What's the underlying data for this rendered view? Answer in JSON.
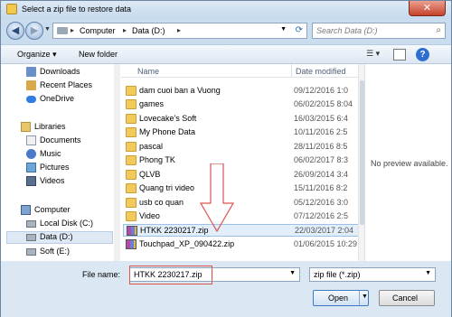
{
  "window": {
    "title": "Select a zip file to restore data",
    "close_glyph": "✕"
  },
  "nav": {
    "back_glyph": "◀",
    "forward_glyph": "▶",
    "address": [
      "Computer",
      "Data (D:)"
    ],
    "search_placeholder": "Search Data (D:)"
  },
  "toolbar": {
    "organize": "Organize ▾",
    "new_folder": "New folder",
    "help": "?"
  },
  "sidebar": {
    "items": [
      {
        "label": "Downloads",
        "icon": "downloads-icon"
      },
      {
        "label": "Recent Places",
        "icon": "recent-places-icon"
      },
      {
        "label": "OneDrive",
        "icon": "onedrive-icon"
      },
      {
        "label": "Libraries",
        "icon": "libraries-icon"
      },
      {
        "label": "Documents",
        "icon": "documents-icon"
      },
      {
        "label": "Music",
        "icon": "music-icon"
      },
      {
        "label": "Pictures",
        "icon": "pictures-icon"
      },
      {
        "label": "Videos",
        "icon": "videos-icon"
      },
      {
        "label": "Computer",
        "icon": "computer-icon"
      },
      {
        "label": "Local Disk (C:)",
        "icon": "drive-icon"
      },
      {
        "label": "Data (D:)",
        "icon": "drive-icon",
        "selected": true
      },
      {
        "label": "Soft  (E:)",
        "icon": "drive-icon"
      }
    ]
  },
  "filelist": {
    "columns": {
      "name": "Name",
      "date": "Date modified"
    },
    "rows": [
      {
        "name": "dam cuoi ban a Vuong",
        "date": "09/12/2016 1:0",
        "type": "folder"
      },
      {
        "name": "games",
        "date": "06/02/2015 8:04",
        "type": "folder"
      },
      {
        "name": "Lovecake's Soft",
        "date": "16/03/2015 6:4",
        "type": "folder"
      },
      {
        "name": "My Phone Data",
        "date": "10/11/2016 2:5",
        "type": "folder"
      },
      {
        "name": "pascal",
        "date": "28/11/2016 8:5",
        "type": "folder"
      },
      {
        "name": "Phong TK",
        "date": "06/02/2017 8:3",
        "type": "folder"
      },
      {
        "name": "QLVB",
        "date": "26/09/2014 3:4",
        "type": "folder"
      },
      {
        "name": "Quang tri video",
        "date": "15/11/2016 8:2",
        "type": "folder"
      },
      {
        "name": "usb co quan",
        "date": "05/12/2016 3:0",
        "type": "folder"
      },
      {
        "name": "Video",
        "date": "07/12/2016 2:5",
        "type": "folder"
      },
      {
        "name": "HTKK 2230217.zip",
        "date": "22/03/2017 2:04",
        "type": "zip",
        "selected": true
      },
      {
        "name": "Touchpad_XP_090422.zip",
        "date": "01/06/2015 10:29",
        "type": "zip"
      }
    ]
  },
  "preview": {
    "text": "No preview available."
  },
  "bottom": {
    "file_name_label": "File name:",
    "file_name_value": "HTKK 2230217.zip",
    "file_type_value": "zip file (*.zip)",
    "open_label": "Open",
    "cancel_label": "Cancel"
  },
  "colors": {
    "accent": "#2f6fcf",
    "highlight_red": "#d9544f",
    "selection": "#e3eefb"
  }
}
